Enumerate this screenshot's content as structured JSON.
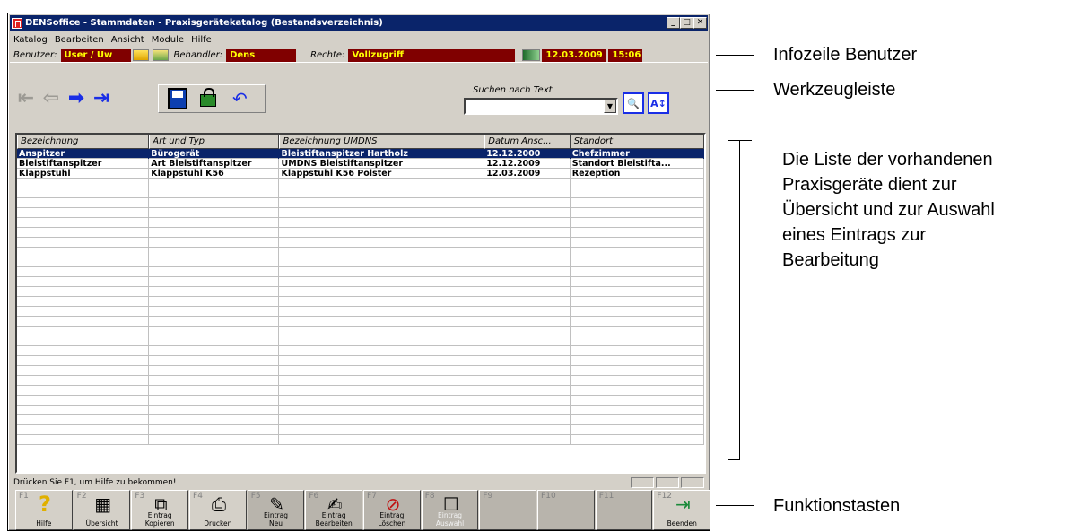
{
  "window": {
    "title": "DENSoffice - Stammdaten - Praxisgerätekatalog (Bestandsverzeichnis)",
    "controls": [
      "_",
      "□",
      "✕"
    ]
  },
  "menu": [
    "Katalog",
    "Bearbeiten",
    "Ansicht",
    "Module",
    "Hilfe"
  ],
  "infoline": {
    "benutzer_label": "Benutzer:",
    "benutzer_value": "User / Uw",
    "behandler_label": "Behandler:",
    "behandler_value": "Dens",
    "rechte_label": "Rechte:",
    "rechte_value": "Vollzugriff",
    "date": "12.03.2009",
    "time": "15:06"
  },
  "toolbar": {
    "search_label": "Suchen nach Text",
    "search_value": ""
  },
  "list": {
    "columns": [
      "Bezeichnung",
      "Art und Typ",
      "Bezeichnung UMDNS",
      "Datum Ansc...",
      "Standort"
    ],
    "rows": [
      [
        "Anspitzer",
        "Bürogerät",
        "Bleistiftanspitzer Hartholz",
        "12.12.2000",
        "Chefzimmer"
      ],
      [
        "Bleistiftanspitzer",
        "Art Bleistiftanspitzer",
        "UMDNS Bleistiftanspitzer",
        "12.12.2009",
        "Standort Bleistifta..."
      ],
      [
        "Klappstuhl",
        "Klappstuhl K56",
        "Klappstuhl K56 Polster",
        "12.03.2009",
        "Rezeption"
      ]
    ],
    "selected_row": 0
  },
  "status_text": "Drücken Sie F1, um Hilfe zu bekommen!",
  "fkeys": [
    {
      "num": "F1",
      "label": "Hilfe",
      "icon": "help-icon"
    },
    {
      "num": "F2",
      "label": "Übersicht",
      "icon": "overview-icon"
    },
    {
      "num": "F3",
      "label": "Eintrag\nKopieren",
      "icon": "copy-icon"
    },
    {
      "num": "F4",
      "label": "Drucken",
      "icon": "printer-icon"
    },
    {
      "num": "F5",
      "label": "Eintrag\nNeu",
      "icon": "new-entry-icon"
    },
    {
      "num": "F6",
      "label": "Eintrag\nBearbeiten",
      "icon": "edit-icon"
    },
    {
      "num": "F7",
      "label": "Eintrag\nLöschen",
      "icon": "delete-icon"
    },
    {
      "num": "F8",
      "label": "Eintrag\nAuswahl",
      "icon": "select-icon"
    },
    {
      "num": "F9",
      "label": "",
      "icon": ""
    },
    {
      "num": "F10",
      "label": "",
      "icon": ""
    },
    {
      "num": "F11",
      "label": "",
      "icon": ""
    },
    {
      "num": "F12",
      "label": "Beenden",
      "icon": "exit-door-icon"
    }
  ],
  "annotations": {
    "infozeile": "Infozeile Benutzer",
    "werkzeugleiste": "Werkzeugleiste",
    "liste": "Die Liste der vorhandenen\nPraxisgeräte dient zur\nÜbersicht und zur Auswahl\neines Eintrags zur\nBearbeitung",
    "funktionstasten": "Funktionstasten"
  }
}
